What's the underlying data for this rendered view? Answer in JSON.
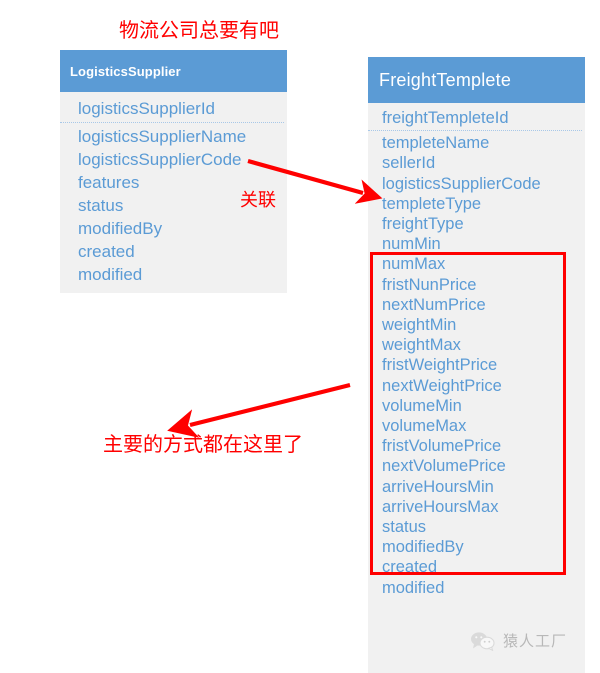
{
  "diagram": {
    "title_note_top": "物流公司总要有吧",
    "title_note_bottom": "主要的方式都在这里了",
    "relation_label": "关联",
    "colors": {
      "header_blue": "#5b9bd5",
      "field_blue": "#5b9bd5",
      "body_gray": "#f1f1f1",
      "annotation_red": "#ff0000",
      "highlight_red": "#ff0000"
    }
  },
  "tables": {
    "logistics_supplier": {
      "name": "LogisticsSupplier",
      "fields": [
        "logisticsSupplierId",
        "logisticsSupplierName",
        "logisticsSupplierCode",
        "features",
        "status",
        "modifiedBy",
        "created",
        "modified"
      ]
    },
    "freight_templete": {
      "name": "FreightTemplete",
      "fields": [
        "freightTempleteId",
        "templeteName",
        "sellerId",
        "logisticsSupplierCode",
        "templeteType",
        "freightType",
        "numMin",
        "numMax",
        "fristNunPrice",
        "nextNumPrice",
        "weightMin",
        "weightMax",
        "fristWeightPrice",
        "nextWeightPrice",
        "volumeMin",
        "volumeMax",
        "fristVolumePrice",
        "nextVolumePrice",
        "arriveHoursMin",
        "arriveHoursMax",
        "status",
        "modifiedBy",
        "created",
        "modified"
      ]
    }
  },
  "watermark": {
    "text": "猿人工厂"
  }
}
